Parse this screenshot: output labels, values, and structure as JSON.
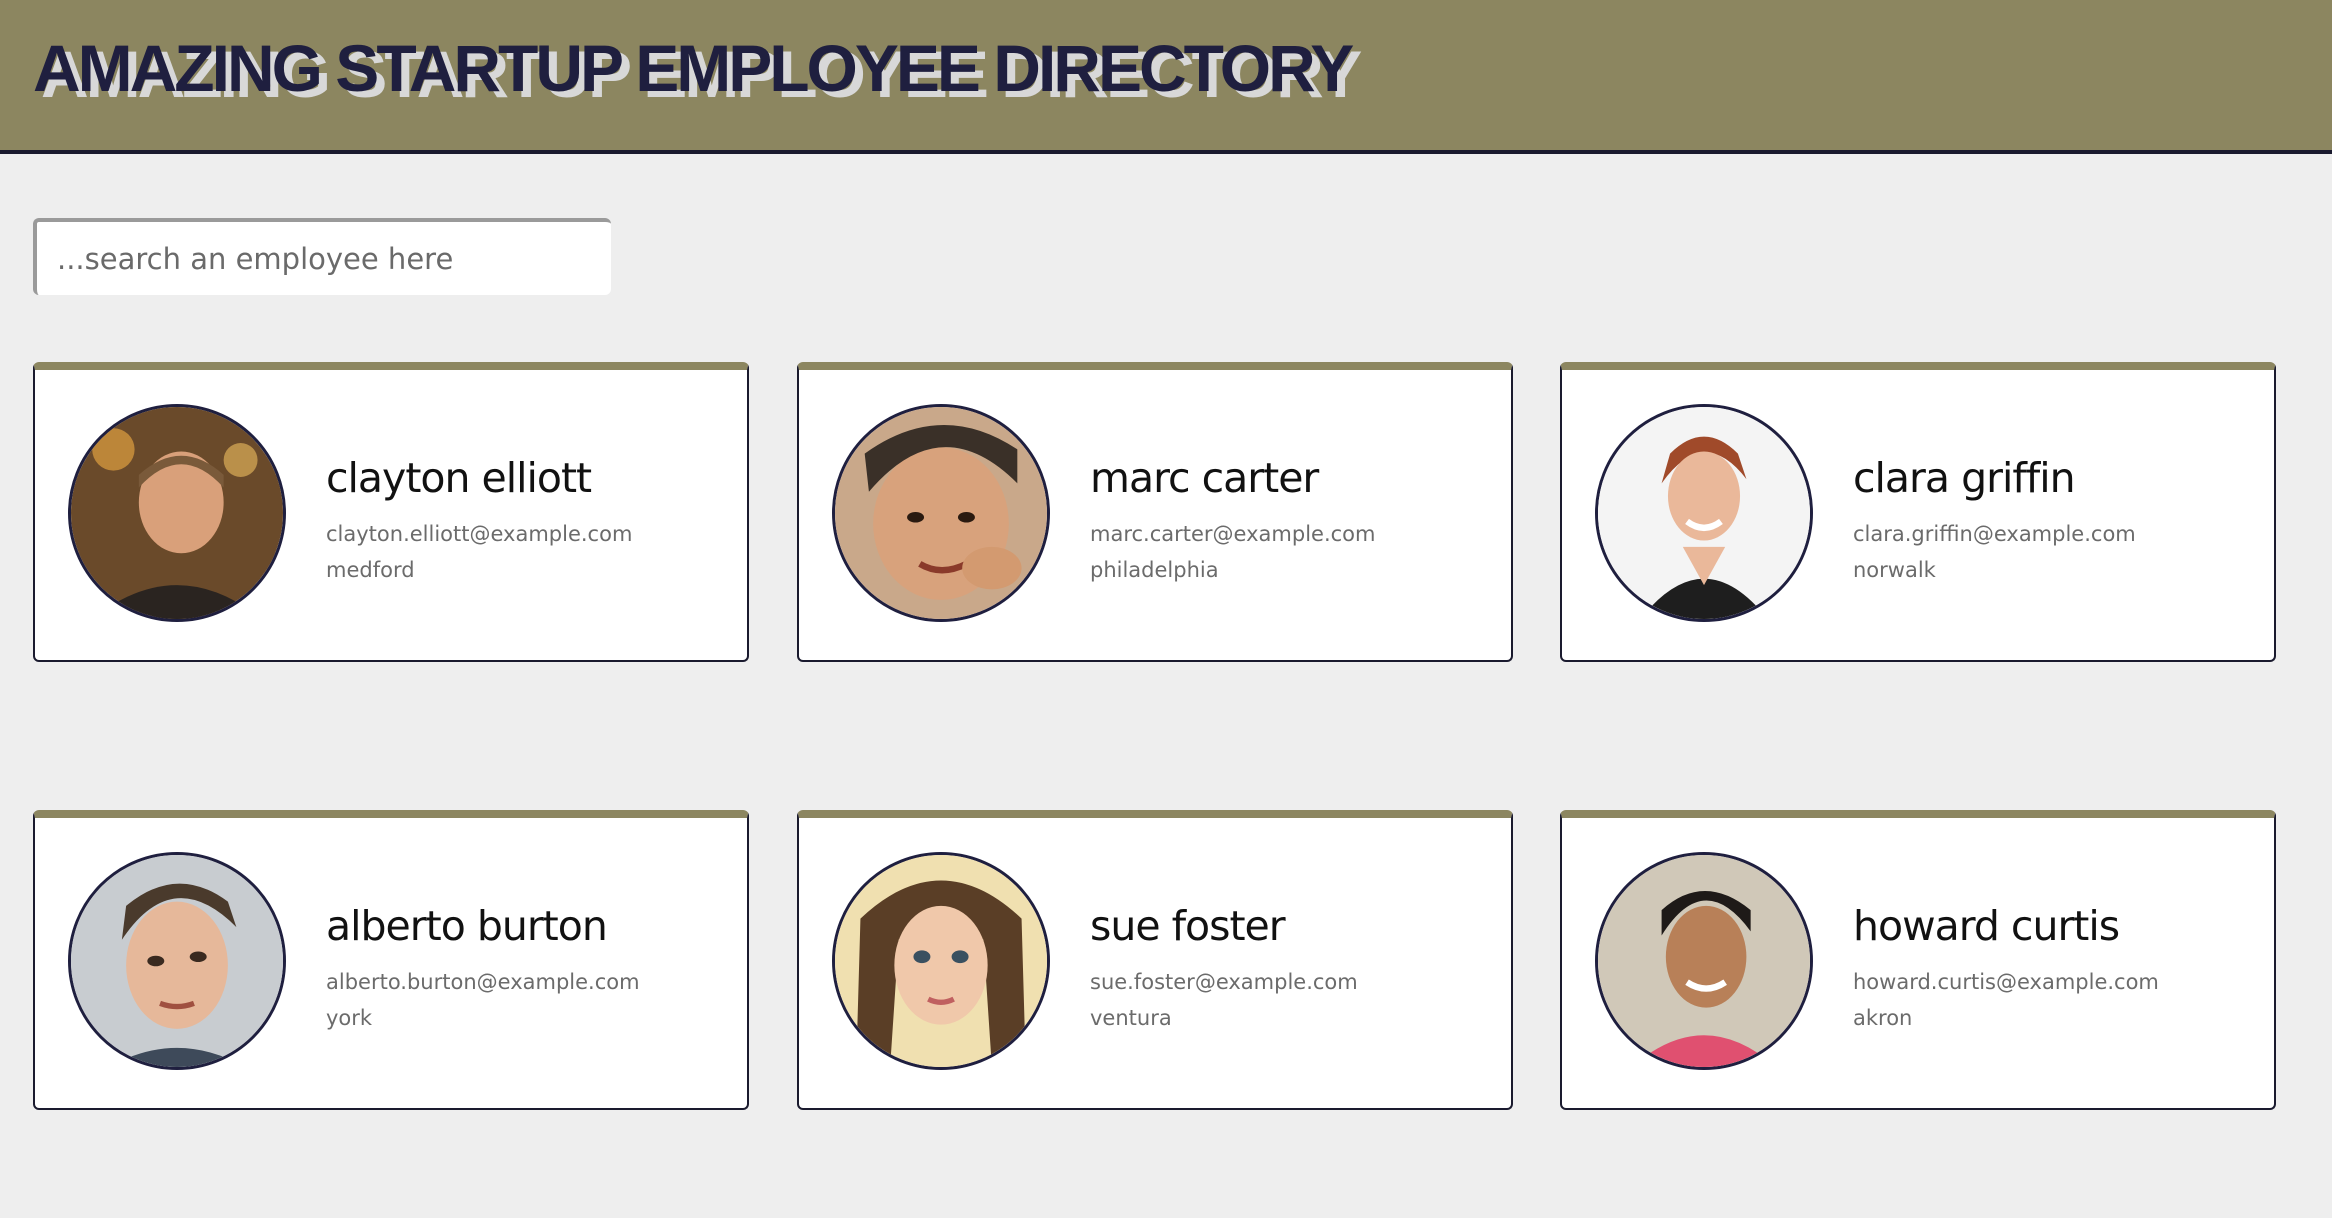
{
  "header": {
    "title": "AMAZING STARTUP EMPLOYEE DIRECTORY"
  },
  "search": {
    "placeholder": "...search an employee here",
    "value": ""
  },
  "colors": {
    "header_bg": "#8c8660",
    "title": "#1f1f3f",
    "page_bg": "#eeeeee",
    "card_border": "#1a1a2e"
  },
  "employees": [
    {
      "name": "clayton elliott",
      "email": "clayton.elliott@example.com",
      "city": "medford",
      "photo": "portrait-photo"
    },
    {
      "name": "marc carter",
      "email": "marc.carter@example.com",
      "city": "philadelphia",
      "photo": "portrait-photo"
    },
    {
      "name": "clara griffin",
      "email": "clara.griffin@example.com",
      "city": "norwalk",
      "photo": "portrait-photo"
    },
    {
      "name": "alberto burton",
      "email": "alberto.burton@example.com",
      "city": "york",
      "photo": "portrait-photo"
    },
    {
      "name": "sue foster",
      "email": "sue.foster@example.com",
      "city": "ventura",
      "photo": "portrait-photo"
    },
    {
      "name": "howard curtis",
      "email": "howard.curtis@example.com",
      "city": "akron",
      "photo": "portrait-photo"
    }
  ]
}
